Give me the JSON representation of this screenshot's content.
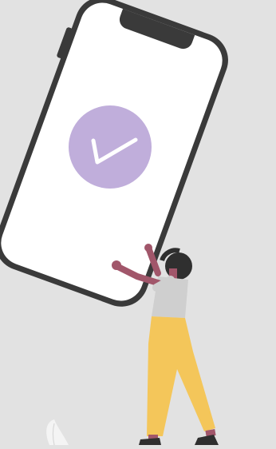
{
  "illustration": {
    "subject": "person-holding-phone-with-checkmark",
    "icons": {
      "phone": "smartphone-icon",
      "check": "checkmark-icon",
      "plant": "leaf-icon"
    },
    "colors": {
      "background": "#e2e2e2",
      "phone_frame": "#3a3a3a",
      "phone_screen": "#ffffff",
      "check_circle": "#c0aedb",
      "check_mark": "#ffffff",
      "skin": "#a1566a",
      "hair": "#2f2f2f",
      "shirt": "#cfcfcf",
      "pants": "#f4c65a",
      "shoes": "#2f2f2f",
      "leaf": "#f4f4f4"
    }
  }
}
